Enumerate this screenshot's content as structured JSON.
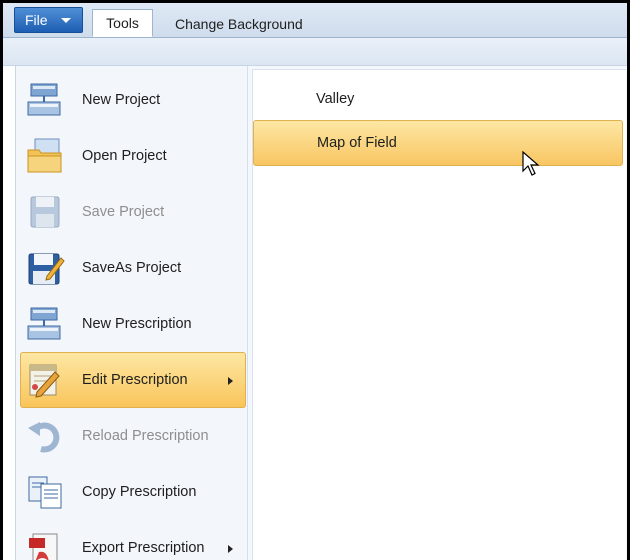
{
  "ribbon": {
    "file_label": "File",
    "tabs": [
      "Tools",
      "Change Background"
    ]
  },
  "menu": {
    "items": [
      {
        "label": "New Project",
        "icon": "new-project-icon",
        "enabled": true
      },
      {
        "label": "Open Project",
        "icon": "open-folder-icon",
        "enabled": true
      },
      {
        "label": "Save Project",
        "icon": "save-disk-icon",
        "enabled": false
      },
      {
        "label": "SaveAs Project",
        "icon": "save-as-icon",
        "enabled": true
      },
      {
        "label": "New Prescription",
        "icon": "new-prescription-icon",
        "enabled": true
      },
      {
        "label": "Edit Prescription",
        "icon": "edit-pencil-icon",
        "enabled": true,
        "submenu": true,
        "highlighted": true
      },
      {
        "label": "Reload Prescription",
        "icon": "reload-icon",
        "enabled": false
      },
      {
        "label": "Copy Prescription",
        "icon": "copy-icon",
        "enabled": true
      },
      {
        "label": "Export Prescription",
        "icon": "export-pdf-icon",
        "enabled": true,
        "submenu": true
      }
    ],
    "submenu_items": [
      {
        "label": "Valley",
        "highlighted": false
      },
      {
        "label": "Map of Field",
        "highlighted": true
      }
    ]
  },
  "colors": {
    "highlight": "#f9c55a",
    "file_button": "#2a6bc0",
    "disabled_text": "#8e8e8e"
  }
}
